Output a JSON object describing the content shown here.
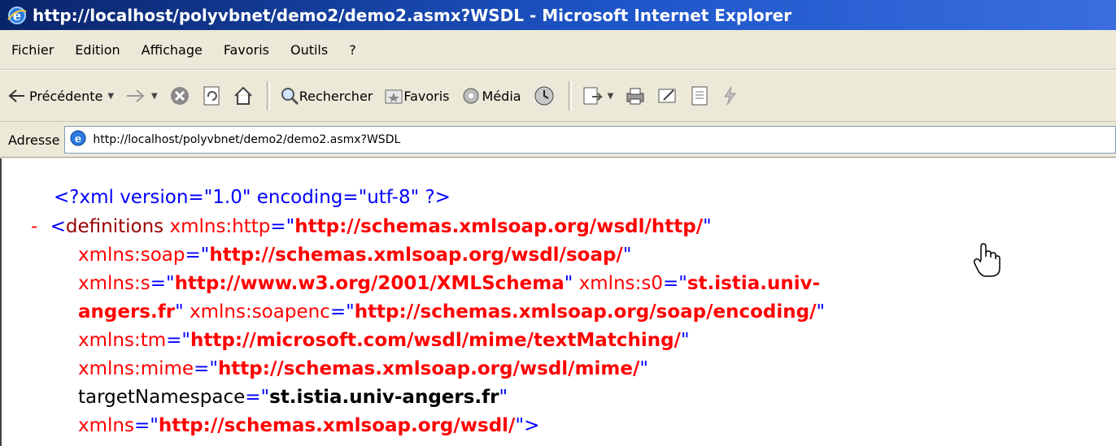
{
  "window": {
    "title": "http://localhost/polyvbnet/demo2/demo2.asmx?WSDL - Microsoft Internet Explorer"
  },
  "menu": [
    "Fichier",
    "Edition",
    "Affichage",
    "Favoris",
    "Outils",
    "?"
  ],
  "toolbar": {
    "back_label": "Précédente",
    "search_label": "Rechercher",
    "favorites_label": "Favoris",
    "media_label": "Média"
  },
  "address": {
    "label": "Adresse",
    "url": "http://localhost/polyvbnet/demo2/demo2.asmx?WSDL"
  },
  "xml": {
    "decl": "<?xml version=\"1.0\" encoding=\"utf-8\" ?>",
    "collapse": "-",
    "def_open": "<definitions",
    "a1_name": "xmlns:http",
    "a1_value": "http://schemas.xmlsoap.org/wsdl/http/",
    "a2_name": "xmlns:soap",
    "a2_value": "http://schemas.xmlsoap.org/wsdl/soap/",
    "a3_name": "xmlns:s",
    "a3_value": "http://www.w3.org/2001/XMLSchema",
    "a4_name": "xmlns:s0",
    "a4_value_part1": "st.istia.univ-",
    "a4_value_part2": "angers.fr",
    "a5_name": "xmlns:soapenc",
    "a5_value": "http://schemas.xmlsoap.org/soap/encoding/",
    "a6_name": "xmlns:tm",
    "a6_value": "http://microsoft.com/wsdl/mime/textMatching/",
    "a7_name": "xmlns:mime",
    "a7_value": "http://schemas.xmlsoap.org/wsdl/mime/",
    "a8_name": "targetNamespace",
    "a8_value": "st.istia.univ-angers.fr",
    "a9_name": "xmlns",
    "a9_value": "http://schemas.xmlsoap.org/wsdl/",
    "tag_close": ">",
    "eq_quote": "=\"",
    "quote": "\""
  }
}
